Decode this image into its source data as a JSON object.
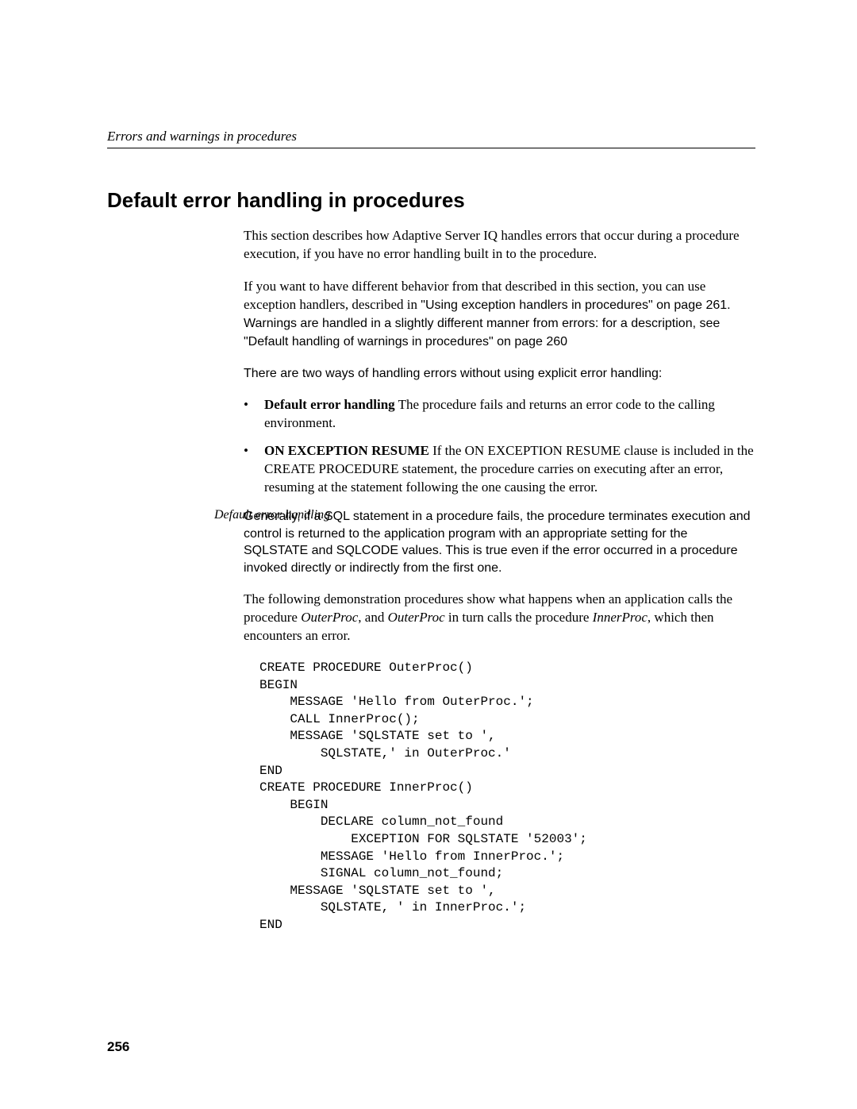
{
  "running_head": "Errors and warnings in procedures",
  "section_title": "Default error handling in procedures",
  "para1": "This section describes how Adaptive Server IQ handles errors that occur during a procedure execution, if you have no error handling built in to the procedure.",
  "para2_a": " If you want to have different behavior from that described in this section, you can use exception handlers, described in ",
  "para2_b": "\"Using exception handlers in procedures\" on page 261",
  "para2_c": ". Warnings are handled in a slightly different manner from errors: for a description, see ",
  "para2_d": "\"Default handling of warnings in procedures\" on page 260",
  "para3": "There are two ways of handling errors without using explicit error handling:",
  "bullet1_label": "Default error handling",
  "bullet1_text": "   The procedure fails and returns an error code to the calling environment.",
  "bullet2_label": "ON EXCEPTION RESUME",
  "bullet2_text": "   If the ON EXCEPTION RESUME clause is included in the CREATE PROCEDURE statement, the procedure carries on executing after an error, resuming at the statement following the one causing the error.",
  "side_label": "Default error handling",
  "para4": "Generally, if a SQL statement in a procedure fails, the procedure terminates execution and control is returned to the application program with an appropriate setting for the SQLSTATE and SQLCODE values. This is true even if the error occurred in a procedure invoked directly or indirectly from the first one.",
  "para5_a": "The following demonstration procedures show what happens when an application calls the procedure ",
  "para5_b": "OuterProc",
  "para5_c": ", and ",
  "para5_d": "OuterProc",
  "para5_e": " in turn calls the procedure ",
  "para5_f": "InnerProc",
  "para5_g": ", which then encounters an error.",
  "code_block": "CREATE PROCEDURE OuterProc()\nBEGIN\n    MESSAGE 'Hello from OuterProc.';\n    CALL InnerProc();\n    MESSAGE 'SQLSTATE set to ',\n        SQLSTATE,' in OuterProc.'\nEND\nCREATE PROCEDURE InnerProc()\n    BEGIN\n        DECLARE column_not_found\n            EXCEPTION FOR SQLSTATE '52003';\n        MESSAGE 'Hello from InnerProc.';\n        SIGNAL column_not_found;\n    MESSAGE 'SQLSTATE set to ',\n        SQLSTATE, ' in InnerProc.';\nEND",
  "page_number": "256"
}
